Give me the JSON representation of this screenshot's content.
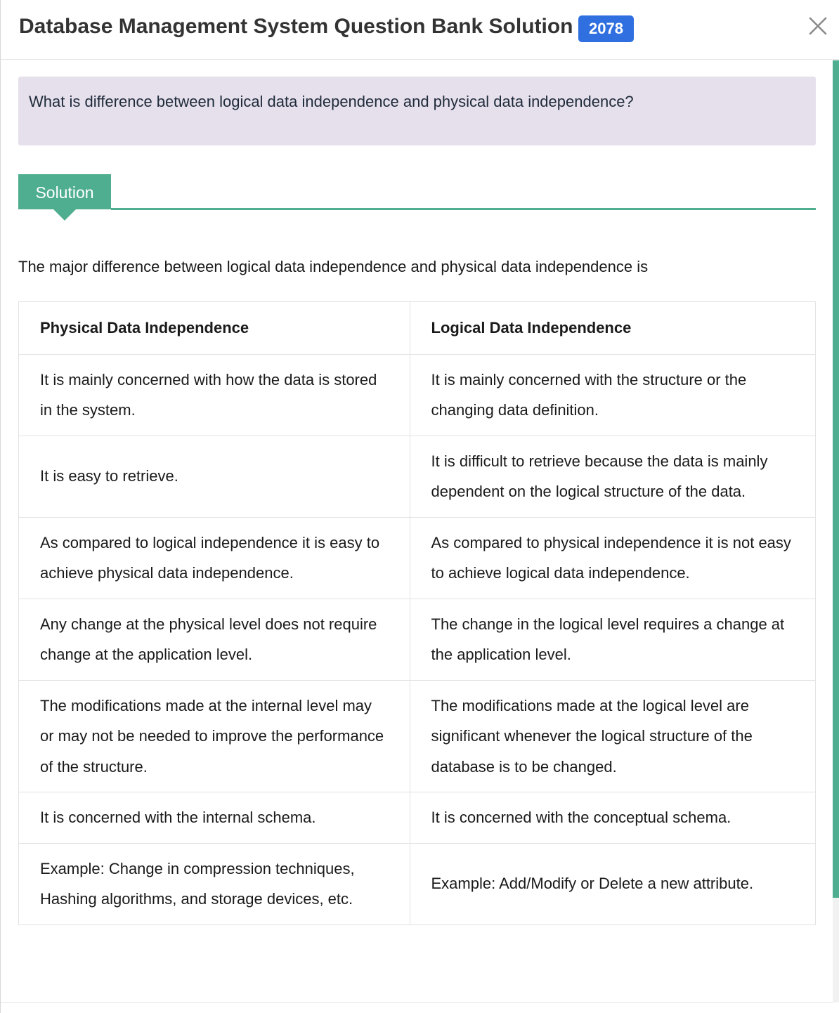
{
  "modal": {
    "title": "Database Management System Question Bank Solution",
    "year_badge": "2078",
    "close_icon": "close-icon"
  },
  "question": {
    "text": "What is difference between logical data independence and physical data independence?"
  },
  "solution": {
    "tab_label": "Solution",
    "intro": "The major difference between logical data independence and physical data independence is",
    "table": {
      "headers": [
        "Physical Data Independence",
        "Logical Data Independence"
      ],
      "rows": [
        [
          "It is mainly concerned with how the data is stored in the system.",
          "It is mainly concerned with the structure or the changing data definition."
        ],
        [
          "It is easy to retrieve.",
          "It is difficult to retrieve because the data is mainly dependent on the logical structure of the data."
        ],
        [
          "As compared to logical independence it is easy to achieve physical data independence.",
          "As compared to physical independence it is not easy to achieve logical data independence."
        ],
        [
          "Any change at the physical level does not require change at the application level.",
          "The change in the logical level requires a change at the application level."
        ],
        [
          "The modifications made at the internal level may or may not be needed to improve the performance of the structure.",
          "The modifications made at the logical level are significant whenever the logical structure of the database is to be changed."
        ],
        [
          "It is concerned with the internal schema.",
          "It is concerned with the conceptual schema."
        ],
        [
          "Example: Change in compression techniques, Hashing algorithms, and storage devices, etc.",
          "Example: Add/Modify or Delete a new attribute."
        ]
      ]
    }
  },
  "colors": {
    "accent": "#4fae8f",
    "badge": "#2f6fe0",
    "question_bg": "#e6e0ec"
  }
}
